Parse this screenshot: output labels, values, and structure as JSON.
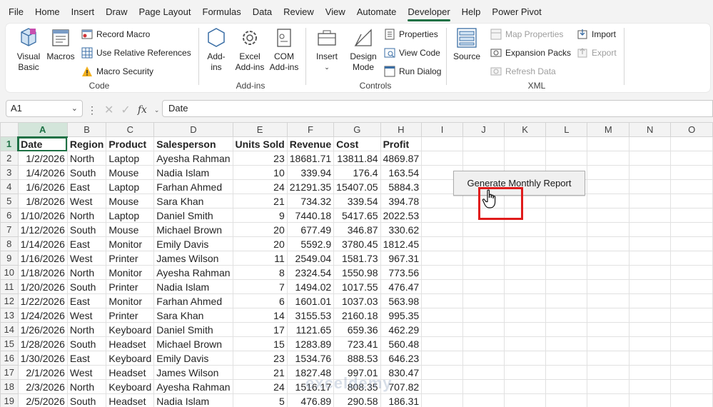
{
  "menu": {
    "tabs": [
      "File",
      "Home",
      "Insert",
      "Draw",
      "Page Layout",
      "Formulas",
      "Data",
      "Review",
      "View",
      "Automate",
      "Developer",
      "Help",
      "Power Pivot"
    ],
    "active_index": 10
  },
  "ribbon": {
    "code": {
      "label": "Code",
      "visual_basic": "Visual Basic",
      "macros": "Macros",
      "record_macro": "Record Macro",
      "use_relative": "Use Relative References",
      "macro_security": "Macro Security"
    },
    "addins": {
      "label": "Add-ins",
      "addins": "Add-ins",
      "excel_addins": "Excel Add-ins",
      "com_addins": "COM Add-ins"
    },
    "controls": {
      "label": "Controls",
      "insert": "Insert",
      "design_mode": "Design Mode",
      "properties": "Properties",
      "view_code": "View Code",
      "run_dialog": "Run Dialog"
    },
    "xml": {
      "label": "XML",
      "source": "Source",
      "map_properties": "Map Properties",
      "expansion_packs": "Expansion Packs",
      "refresh_data": "Refresh Data",
      "import": "Import",
      "export": "Export"
    }
  },
  "formula_bar": {
    "name_box": "A1",
    "fx": "fx",
    "formula": "Date"
  },
  "sheet": {
    "columns": [
      "A",
      "B",
      "C",
      "D",
      "E",
      "F",
      "G",
      "H",
      "I",
      "J",
      "K",
      "L",
      "M",
      "N",
      "O"
    ],
    "header_row": [
      "Date",
      "Region",
      "Product",
      "Salesperson",
      "Units Sold",
      "Revenue",
      "Cost",
      "Profit"
    ],
    "rows": [
      [
        "1/2/2026",
        "North",
        "Laptop",
        "Ayesha Rahman",
        "23",
        "18681.71",
        "13811.84",
        "4869.87"
      ],
      [
        "1/4/2026",
        "South",
        "Mouse",
        "Nadia Islam",
        "10",
        "339.94",
        "176.4",
        "163.54"
      ],
      [
        "1/6/2026",
        "East",
        "Laptop",
        "Farhan Ahmed",
        "24",
        "21291.35",
        "15407.05",
        "5884.3"
      ],
      [
        "1/8/2026",
        "West",
        "Mouse",
        "Sara Khan",
        "21",
        "734.32",
        "339.54",
        "394.78"
      ],
      [
        "1/10/2026",
        "North",
        "Laptop",
        "Daniel Smith",
        "9",
        "7440.18",
        "5417.65",
        "2022.53"
      ],
      [
        "1/12/2026",
        "South",
        "Mouse",
        "Michael Brown",
        "20",
        "677.49",
        "346.87",
        "330.62"
      ],
      [
        "1/14/2026",
        "East",
        "Monitor",
        "Emily Davis",
        "20",
        "5592.9",
        "3780.45",
        "1812.45"
      ],
      [
        "1/16/2026",
        "West",
        "Printer",
        "James Wilson",
        "11",
        "2549.04",
        "1581.73",
        "967.31"
      ],
      [
        "1/18/2026",
        "North",
        "Monitor",
        "Ayesha Rahman",
        "8",
        "2324.54",
        "1550.98",
        "773.56"
      ],
      [
        "1/20/2026",
        "South",
        "Printer",
        "Nadia Islam",
        "7",
        "1494.02",
        "1017.55",
        "476.47"
      ],
      [
        "1/22/2026",
        "East",
        "Monitor",
        "Farhan Ahmed",
        "6",
        "1601.01",
        "1037.03",
        "563.98"
      ],
      [
        "1/24/2026",
        "West",
        "Printer",
        "Sara Khan",
        "14",
        "3155.53",
        "2160.18",
        "995.35"
      ],
      [
        "1/26/2026",
        "North",
        "Keyboard",
        "Daniel Smith",
        "17",
        "1121.65",
        "659.36",
        "462.29"
      ],
      [
        "1/28/2026",
        "South",
        "Headset",
        "Michael Brown",
        "15",
        "1283.89",
        "723.41",
        "560.48"
      ],
      [
        "1/30/2026",
        "East",
        "Keyboard",
        "Emily Davis",
        "23",
        "1534.76",
        "888.53",
        "646.23"
      ],
      [
        "2/1/2026",
        "West",
        "Headset",
        "James Wilson",
        "21",
        "1827.48",
        "997.01",
        "830.47"
      ],
      [
        "2/3/2026",
        "North",
        "Keyboard",
        "Ayesha Rahman",
        "24",
        "1516.17",
        "808.35",
        "707.82"
      ],
      [
        "2/5/2026",
        "South",
        "Headset",
        "Nadia Islam",
        "5",
        "476.89",
        "290.58",
        "186.31"
      ]
    ]
  },
  "button": {
    "label": "Generate Monthly Report"
  },
  "watermark": "exceldemy",
  "colors": {
    "accent": "#1e7145",
    "highlight": "#e01b1b"
  }
}
